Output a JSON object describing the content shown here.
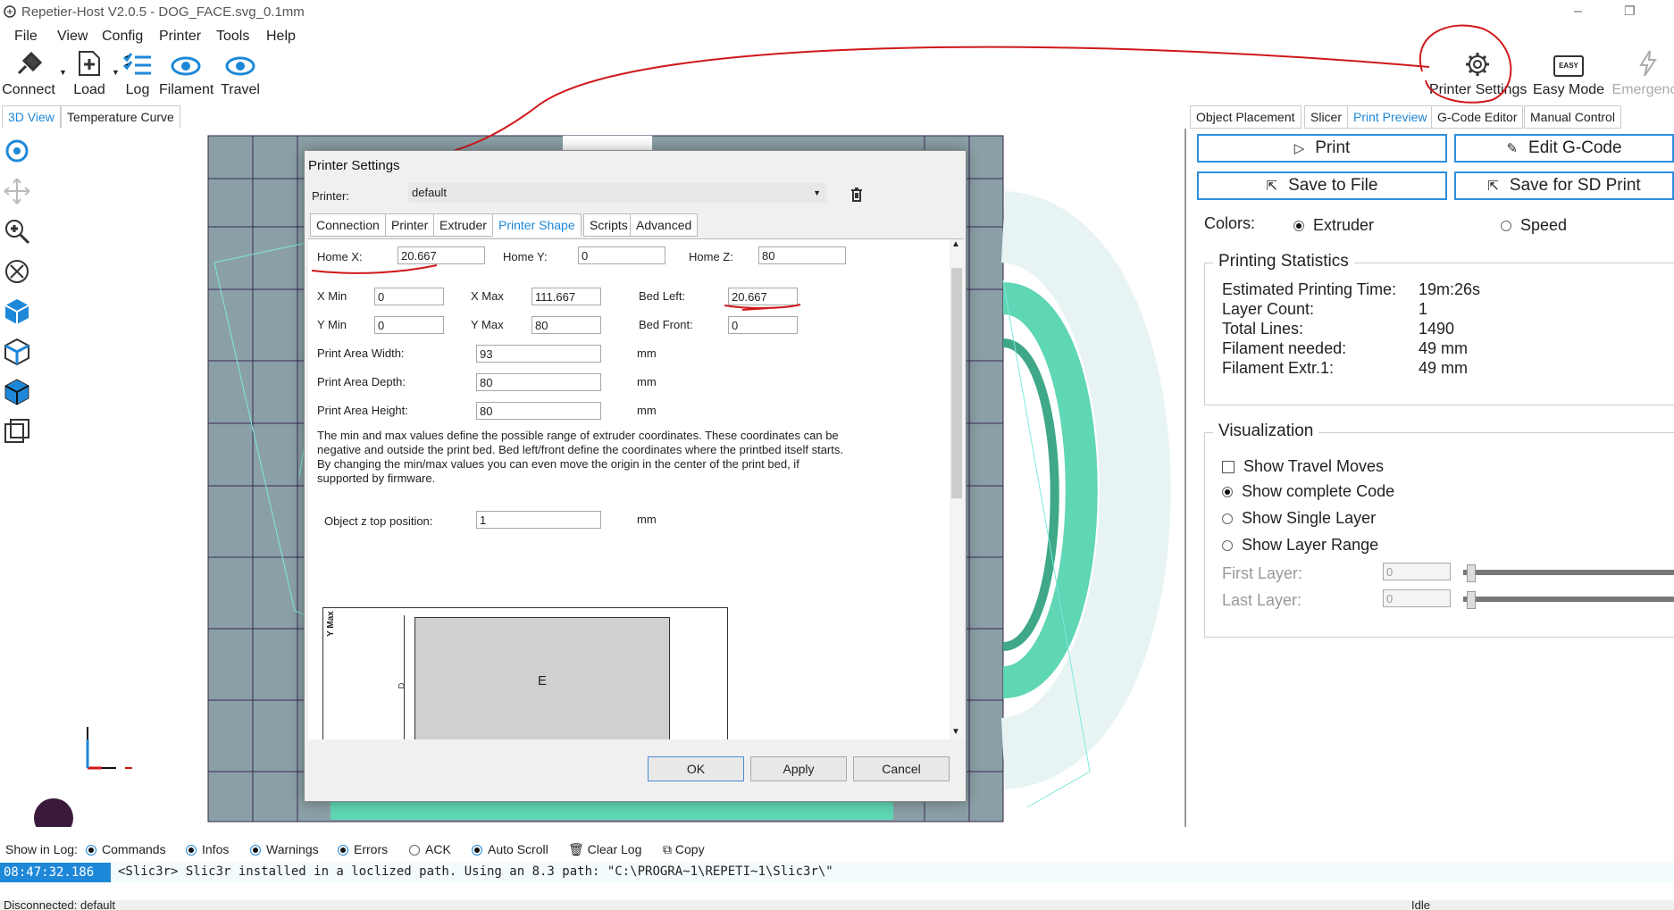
{
  "window": {
    "title": "Repetier-Host V2.0.5 - DOG_FACE.svg_0.1mm"
  },
  "menu": [
    "File",
    "View",
    "Config",
    "Printer",
    "Tools",
    "Help"
  ],
  "toolbar": {
    "connect": "Connect",
    "load": "Load",
    "log": "Log",
    "filament": "Filament",
    "travel": "Travel",
    "printer_settings": "Printer Settings",
    "easy_mode": "Easy Mode",
    "easy_icon_text": "EASY",
    "emergency": "Emergency"
  },
  "left_tabs": [
    "3D View",
    "Temperature Curve"
  ],
  "dialog": {
    "title": "Printer Settings",
    "printer_label": "Printer:",
    "printer_value": "default",
    "tabs": [
      "Connection",
      "Printer",
      "Extruder",
      "Printer Shape",
      "Scripts",
      "Advanced"
    ],
    "active_tab": "Printer Shape",
    "home_x_label": "Home X:",
    "home_x": "20.667",
    "home_y_label": "Home Y:",
    "home_y": "0",
    "home_z_label": "Home Z:",
    "home_z": "80",
    "x_min_label": "X Min",
    "x_min": "0",
    "x_max_label": "X Max",
    "x_max": "111.667",
    "bed_left_label": "Bed Left:",
    "bed_left": "20.667",
    "y_min_label": "Y Min",
    "y_min": "0",
    "y_max_label": "Y Max",
    "y_max": "80",
    "bed_front_label": "Bed Front:",
    "bed_front": "0",
    "width_label": "Print Area Width:",
    "width": "93",
    "depth_label": "Print Area Depth:",
    "depth": "80",
    "height_label": "Print Area Height:",
    "height": "80",
    "unit": "mm",
    "description": "The min and max values define the possible range of extruder coordinates. These coordinates can be negative and outside the print bed. Bed left/front define the coordinates where the printbed itself starts. By changing the min/max values you can even move the origin in the center of the print bed, if supported by firmware.",
    "zpos_label": "Object z top position:",
    "zpos": "1",
    "diagram_ymax": "Y Max",
    "diagram_d": "D",
    "diagram_e": "E",
    "ok": "OK",
    "apply": "Apply",
    "cancel": "Cancel"
  },
  "right_tabs": [
    "Object Placement",
    "Slicer",
    "Print Preview",
    "G-Code Editor",
    "Manual Control"
  ],
  "right": {
    "print": "Print",
    "edit_gcode": "Edit G-Code",
    "save_file": "Save to File",
    "save_sd": "Save for SD Print",
    "colors_label": "Colors:",
    "color_extruder": "Extruder",
    "color_speed": "Speed",
    "stats_title": "Printing Statistics",
    "stats": [
      {
        "label": "Estimated Printing Time:",
        "value": "19m:26s"
      },
      {
        "label": "Layer Count:",
        "value": "1"
      },
      {
        "label": "Total Lines:",
        "value": "1490"
      },
      {
        "label": "Filament needed:",
        "value": "49 mm"
      },
      {
        "label": "Filament Extr.1:",
        "value": "49 mm"
      }
    ],
    "vis_title": "Visualization",
    "vis_travel": "Show Travel Moves",
    "vis_complete": "Show complete Code",
    "vis_single": "Show Single Layer",
    "vis_range": "Show Layer Range",
    "first_layer": "First Layer:",
    "last_layer": "Last Layer:",
    "first_value": "0",
    "last_value": "0"
  },
  "log": {
    "show_label": "Show in Log:",
    "commands": "Commands",
    "infos": "Infos",
    "warnings": "Warnings",
    "errors": "Errors",
    "ack": "ACK",
    "autoscroll": "Auto Scroll",
    "clear": "Clear Log",
    "copy": "Copy",
    "time": "08:47:32.186",
    "message": "<Slic3r> Slic3r installed in a loclized path. Using an 8.3 path: \"C:\\PROGRA~1\\REPETI~1\\Slic3r\\\""
  },
  "status": {
    "left": "Disconnected: default",
    "right": "Idle"
  },
  "colors": {
    "accent": "#1e88d8",
    "annotation": "#d0181b",
    "model": "#5fd6b4",
    "bed": "#8aa0a6"
  }
}
